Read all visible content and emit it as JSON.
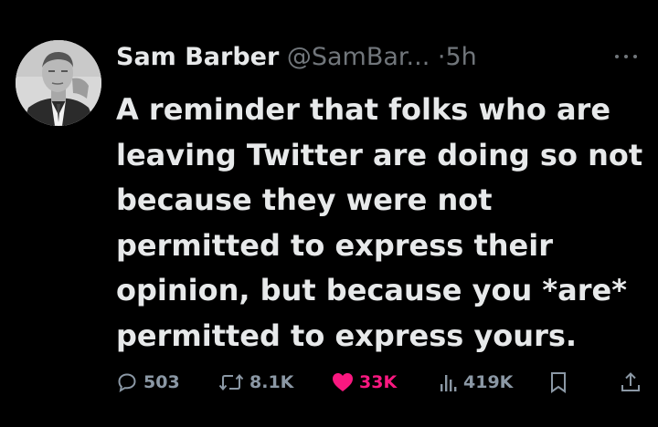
{
  "tweet": {
    "author": {
      "display_name": "Sam Barber",
      "handle": "@SamBar...",
      "separator": "·",
      "time": "5h",
      "avatar": "avatar-photo"
    },
    "more_icon": "more-icon",
    "text": "A reminder that folks who are leaving Twitter are doing so not because they were not permitted to express their opinion, but because you *are* permitted to express yours.",
    "actions": {
      "replies": "503",
      "retweets": "8.1K",
      "likes": "33K",
      "views": "419K"
    }
  },
  "colors": {
    "background": "#000000",
    "text": "#e7e9ea",
    "muted": "#71767b",
    "like": "#f91880"
  }
}
